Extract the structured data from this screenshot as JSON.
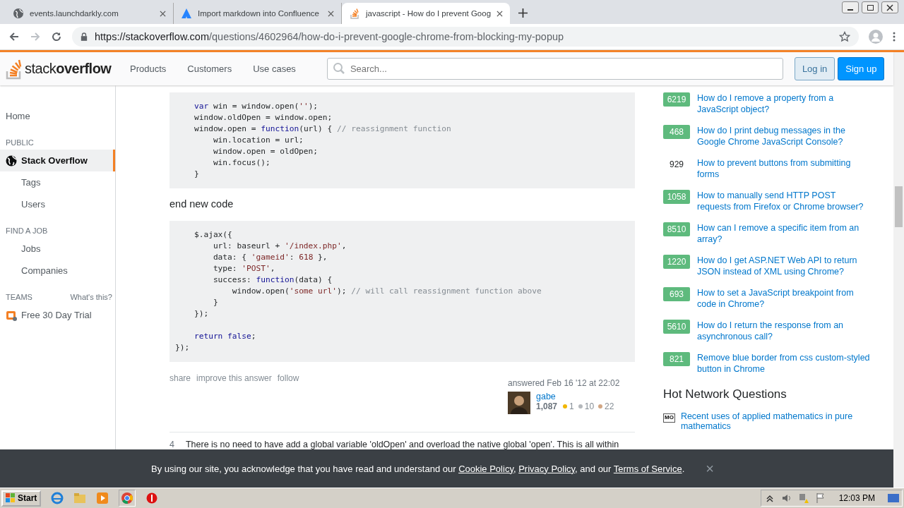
{
  "browser": {
    "tabs": [
      {
        "title": "events.launchdarkly.com",
        "selected": false
      },
      {
        "title": "Import markdown into Confluence",
        "selected": false
      },
      {
        "title": "javascript - How do I prevent Goog",
        "selected": true
      }
    ],
    "address": {
      "host": "https://stackoverflow.com",
      "path": "/questions/4602964/how-do-i-prevent-google-chrome-from-blocking-my-popup"
    }
  },
  "header": {
    "logo_light": "stack",
    "logo_bold": "overflow",
    "nav": [
      "Products",
      "Customers",
      "Use cases"
    ],
    "search": {
      "placeholder": "Search..."
    },
    "login": "Log in",
    "signup": "Sign up"
  },
  "sidebar": [
    {
      "kind": "link",
      "label": "Home",
      "selected": false
    },
    {
      "kind": "heading",
      "label": "PUBLIC"
    },
    {
      "kind": "link",
      "label": "Stack Overflow",
      "selected": true
    },
    {
      "kind": "sublink",
      "label": "Tags",
      "selected": false
    },
    {
      "kind": "sublink",
      "label": "Users",
      "selected": false
    },
    {
      "kind": "heading",
      "label": "FIND A JOB"
    },
    {
      "kind": "sublink",
      "label": "Jobs",
      "selected": false
    },
    {
      "kind": "sublink",
      "label": "Companies",
      "selected": false
    },
    {
      "kind": "heading",
      "label": "TEAMS",
      "aside": "What's this?"
    },
    {
      "kind": "link",
      "label": "Free 30 Day Trial",
      "selected": false
    }
  ],
  "answer": {
    "blocks": [
      {
        "kind": "code",
        "lines": [
          {
            "tokens": [
              {
                "t": "    var",
                "kind": "keyword"
              },
              {
                "t": " win = window.open("
              },
              {
                "t": "''",
                "kind": "string"
              },
              {
                "t": ");"
              }
            ]
          },
          {
            "tokens": [
              {
                "t": "    window.oldOpen = window.open;"
              }
            ]
          },
          {
            "tokens": [
              {
                "t": "    window.open = "
              },
              {
                "t": "function",
                "kind": "keyword"
              },
              {
                "t": "(url) { "
              },
              {
                "t": "// reassignment function",
                "kind": "comment"
              }
            ]
          },
          {
            "tokens": [
              {
                "t": "        win.location = url;"
              }
            ]
          },
          {
            "tokens": [
              {
                "t": "        window.open = oldOpen;"
              }
            ]
          },
          {
            "tokens": [
              {
                "t": "        win.focus();"
              }
            ]
          },
          {
            "tokens": [
              {
                "t": "    }"
              }
            ]
          }
        ]
      },
      {
        "kind": "text",
        "text": "end new code"
      },
      {
        "kind": "code",
        "lines": [
          {
            "tokens": [
              {
                "t": "    $.ajax({"
              }
            ]
          },
          {
            "tokens": [
              {
                "t": "        url: baseurl + "
              },
              {
                "t": "'/index.php'",
                "kind": "string"
              },
              {
                "t": ","
              }
            ]
          },
          {
            "tokens": [
              {
                "t": "        data: { "
              },
              {
                "t": "'gameid'",
                "kind": "string"
              },
              {
                "t": ": "
              },
              {
                "t": "618",
                "kind": "string"
              },
              {
                "t": " },"
              }
            ]
          },
          {
            "tokens": [
              {
                "t": "        type: "
              },
              {
                "t": "'POST'",
                "kind": "string"
              },
              {
                "t": ","
              }
            ]
          },
          {
            "tokens": [
              {
                "t": "        success: "
              },
              {
                "t": "function",
                "kind": "keyword"
              },
              {
                "t": "(data) {"
              }
            ]
          },
          {
            "tokens": [
              {
                "t": "            window.open("
              },
              {
                "t": "'some url'",
                "kind": "string"
              },
              {
                "t": "); "
              },
              {
                "t": "// will call reassignment function above",
                "kind": "comment"
              }
            ]
          },
          {
            "tokens": [
              {
                "t": "        }"
              }
            ]
          },
          {
            "tokens": [
              {
                "t": "    });"
              }
            ]
          },
          {
            "kind": "blank"
          },
          {
            "tokens": [
              {
                "t": "    return false",
                "kind": "keyword"
              },
              {
                "t": ";"
              }
            ]
          },
          {
            "tokens": [
              {
                "t": "});"
              }
            ]
          }
        ]
      }
    ],
    "actions": [
      "share",
      "improve this answer",
      "follow"
    ],
    "answered": "answered Feb 16 '12 at 22:02",
    "user": {
      "name": "gabe",
      "reputation": "1,087",
      "badges": [
        {
          "count": "1",
          "color": "#f1b600"
        },
        {
          "count": "10",
          "color": "#b4b8bc"
        },
        {
          "count": "22",
          "color": "#d1a684"
        }
      ]
    }
  },
  "next_answer": {
    "votes": "4",
    "text": "There is no need to have add a global variable 'oldOpen' and overload the native global 'open'. This is all within"
  },
  "linked": [
    {
      "votes": "6219",
      "answered": true,
      "title": "How do I remove a property from a JavaScript object?"
    },
    {
      "votes": "468",
      "answered": true,
      "title": "How do I print debug messages in the Google Chrome JavaScript Console?"
    },
    {
      "votes": "929",
      "answered": false,
      "title": "How to prevent buttons from submitting forms"
    },
    {
      "votes": "1058",
      "answered": true,
      "title": "How to manually send HTTP POST requests from Firefox or Chrome browser?"
    },
    {
      "votes": "8510",
      "answered": true,
      "title": "How can I remove a specific item from an array?"
    },
    {
      "votes": "1220",
      "answered": true,
      "title": "How do I get ASP.NET Web API to return JSON instead of XML using Chrome?"
    },
    {
      "votes": "693",
      "answered": true,
      "title": "How to set a JavaScript breakpoint from code in Chrome?"
    },
    {
      "votes": "5610",
      "answered": true,
      "title": "How do I return the response from an asynchronous call?"
    },
    {
      "votes": "821",
      "answered": true,
      "title": "Remove blue border from css custom-styled button in Chrome"
    }
  ],
  "hot": {
    "title": "Hot Network Questions",
    "items": [
      {
        "site": "MO",
        "title": "Recent uses of applied mathematics in pure mathematics"
      }
    ]
  },
  "cookie": {
    "before": "By using our site, you acknowledge that you have read and understand our ",
    "links": [
      "Cookie Policy",
      "Privacy Policy",
      "Terms of Service"
    ],
    "sep1": ", ",
    "sep2": ", and our ",
    "end": ".",
    "close": "×"
  },
  "taskbar": {
    "start": "Start",
    "clock": "12:03 PM"
  }
}
